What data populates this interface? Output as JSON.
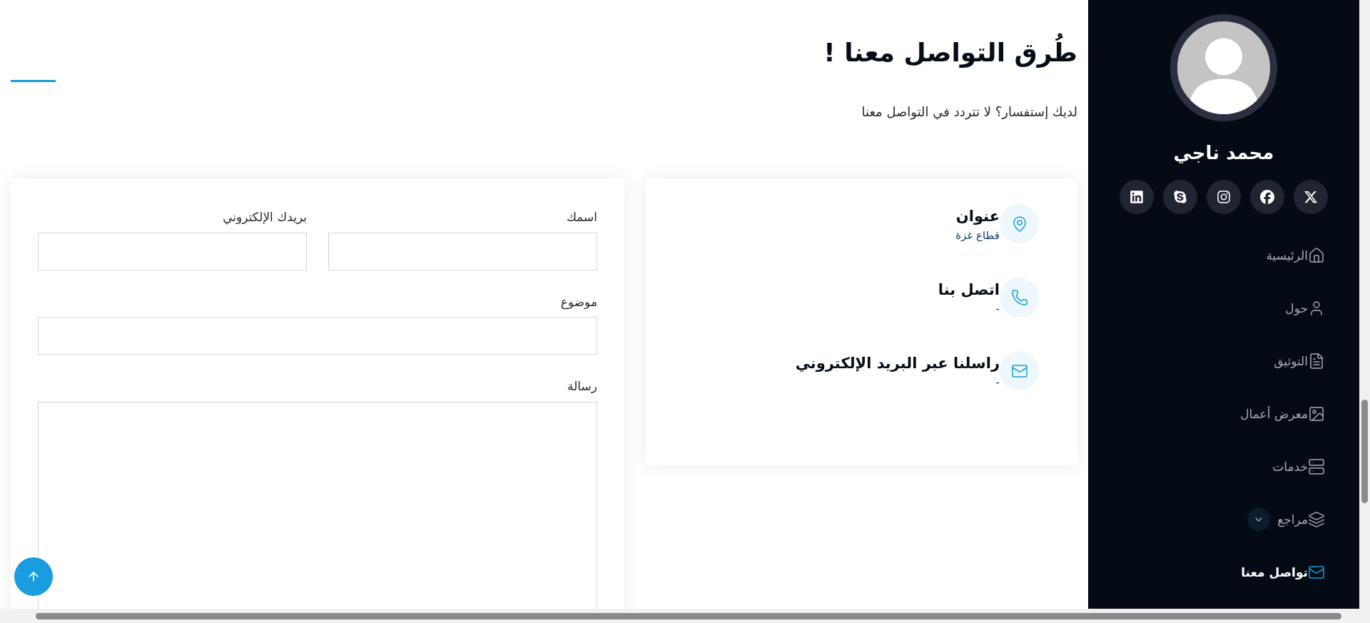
{
  "sidebar": {
    "name": "محمد ناجي",
    "social_links": [
      {
        "kind": "x"
      },
      {
        "kind": "facebook"
      },
      {
        "kind": "instagram"
      },
      {
        "kind": "skype"
      },
      {
        "kind": "linkedin"
      }
    ],
    "nav": [
      {
        "label": "الرئيسية",
        "kind": "home",
        "selected": false
      },
      {
        "label": "حول",
        "kind": "user",
        "selected": false
      },
      {
        "label": "التوثيق",
        "kind": "document",
        "selected": false
      },
      {
        "label": "معرض أعمال",
        "kind": "image",
        "selected": false
      },
      {
        "label": "خدمات",
        "kind": "server",
        "selected": false
      },
      {
        "label": "مراجع",
        "kind": "stack",
        "selected": false,
        "submenu": {
          "expanded": false
        }
      },
      {
        "label": "تواصل معنا",
        "kind": "mail",
        "selected": true
      }
    ]
  },
  "main": {
    "title": "طُرق التواصل معنا !",
    "subtitle": "لديك إستفسار؟ لا تتردد في التواصل معنا",
    "contact_info": [
      {
        "kind": "address",
        "title": "عنوان",
        "value": "قطاع غزة"
      },
      {
        "kind": "phone",
        "title": "اتصل بنا",
        "value": "-"
      },
      {
        "kind": "email",
        "title": "راسلنا عبر البريد الإلكتروني",
        "value": "-"
      }
    ],
    "form": {
      "fields": [
        {
          "label": "اسمك",
          "kind": "half"
        },
        {
          "label": "بريدك الإلكتروني",
          "kind": "half"
        },
        {
          "label": "موضوع",
          "kind": "full"
        },
        {
          "label": "رسالة",
          "kind": "textarea"
        }
      ]
    }
  }
}
